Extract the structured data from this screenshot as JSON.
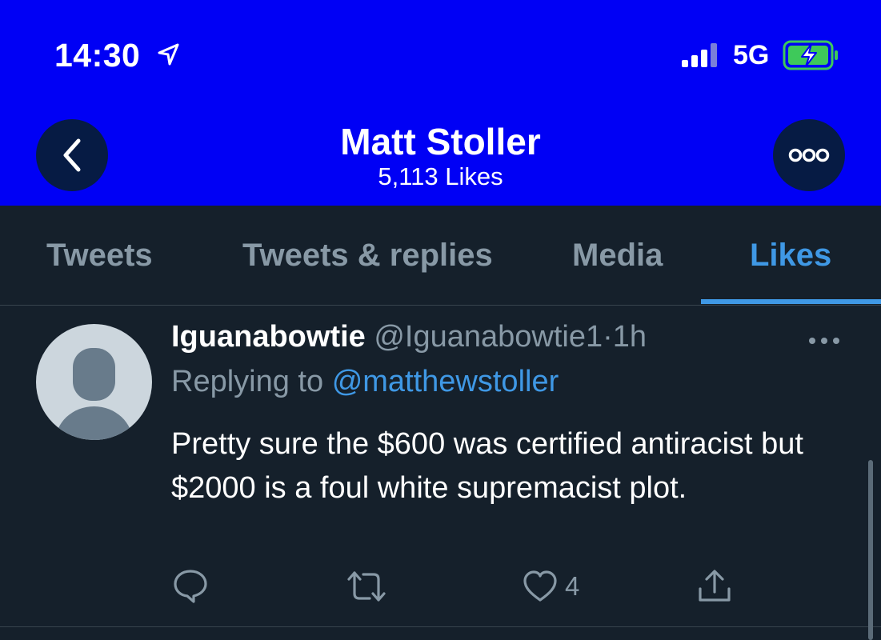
{
  "status_bar": {
    "time": "14:30",
    "network": "5G",
    "icons": [
      "location-arrow-icon",
      "signal-icon",
      "battery-charging-icon"
    ]
  },
  "header": {
    "profile_name": "Matt Stoller",
    "likes_count": "5,113 Likes",
    "background_color": "#0000f5",
    "icons": [
      "back-chevron-icon",
      "more-options-icon"
    ]
  },
  "tabs": {
    "items": [
      {
        "label": "Tweets"
      },
      {
        "label": "Tweets & replies"
      },
      {
        "label": "Media"
      },
      {
        "label": "Likes"
      }
    ],
    "active": "Likes",
    "active_color": "#3f98e5"
  },
  "tweet": {
    "author_name": "Iguanabowtie",
    "author_handle": "@Iguanabowtie1",
    "separator": "·",
    "timestamp": "1h",
    "replying_label": "Replying to",
    "replying_handle": "@matthewstoller",
    "text": "Pretty sure the $600 was certified antiracist but $2000 is a foul white supremacist plot.",
    "actions": {
      "reply_icon": "comment-icon",
      "retweet_icon": "retweet-icon",
      "like_icon": "heart-icon",
      "like_count": "4",
      "share_icon": "share-icon"
    }
  }
}
